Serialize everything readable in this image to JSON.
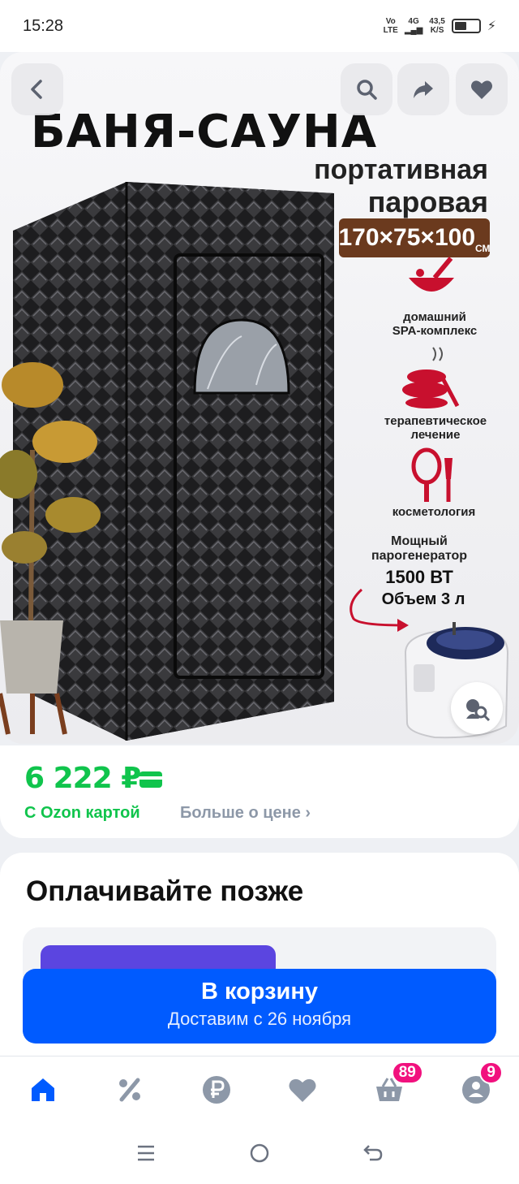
{
  "status_bar": {
    "time": "15:28",
    "volte_top": "Vo",
    "volte_bottom": "LTE",
    "network": "4G",
    "speed_value": "43,5",
    "speed_unit": "K/S"
  },
  "hero": {
    "title": "БАНЯ-САУНА",
    "subtitle_line1": "портативная",
    "subtitle_line2": "паровая",
    "dimensions": "170×75×100",
    "dimensions_unit": "СМ",
    "features": [
      {
        "label_line1": "домашний",
        "label_line2": "SPA-комплекс"
      },
      {
        "label_line1": "терапевтическое",
        "label_line2": "лечение"
      },
      {
        "label_line1": "косметология",
        "label_line2": ""
      }
    ],
    "power_label_line1": "Мощный",
    "power_label_line2": "парогенератор",
    "power_value": "1500 ВТ",
    "volume_value": "Объем 3 л",
    "icons": {
      "back": "back-arrow-icon",
      "search": "search-icon",
      "share": "share-icon",
      "favorite": "heart-icon",
      "similar": "similar-search-icon"
    }
  },
  "price": {
    "value": "6 222 ₽",
    "ozon_card_label": "С Ozon картой",
    "more_label": "Больше о цене",
    "accent_color": "#10c44c"
  },
  "pay_later": {
    "title": "Оплачивайте позже"
  },
  "cart_button": {
    "label": "В корзину",
    "delivery": "Доставим с 26 ноября",
    "color": "#005bff"
  },
  "bottom_nav": {
    "items": [
      {
        "name": "home",
        "icon": "home-icon",
        "active": true
      },
      {
        "name": "discounts",
        "icon": "percent-icon"
      },
      {
        "name": "ruble",
        "icon": "ruble-icon"
      },
      {
        "name": "favorites",
        "icon": "heart-icon"
      },
      {
        "name": "cart",
        "icon": "basket-icon",
        "badge": "89"
      },
      {
        "name": "profile",
        "icon": "profile-icon",
        "badge": "9"
      }
    ],
    "active_color": "#005bff",
    "badge_color": "#f1117e"
  }
}
